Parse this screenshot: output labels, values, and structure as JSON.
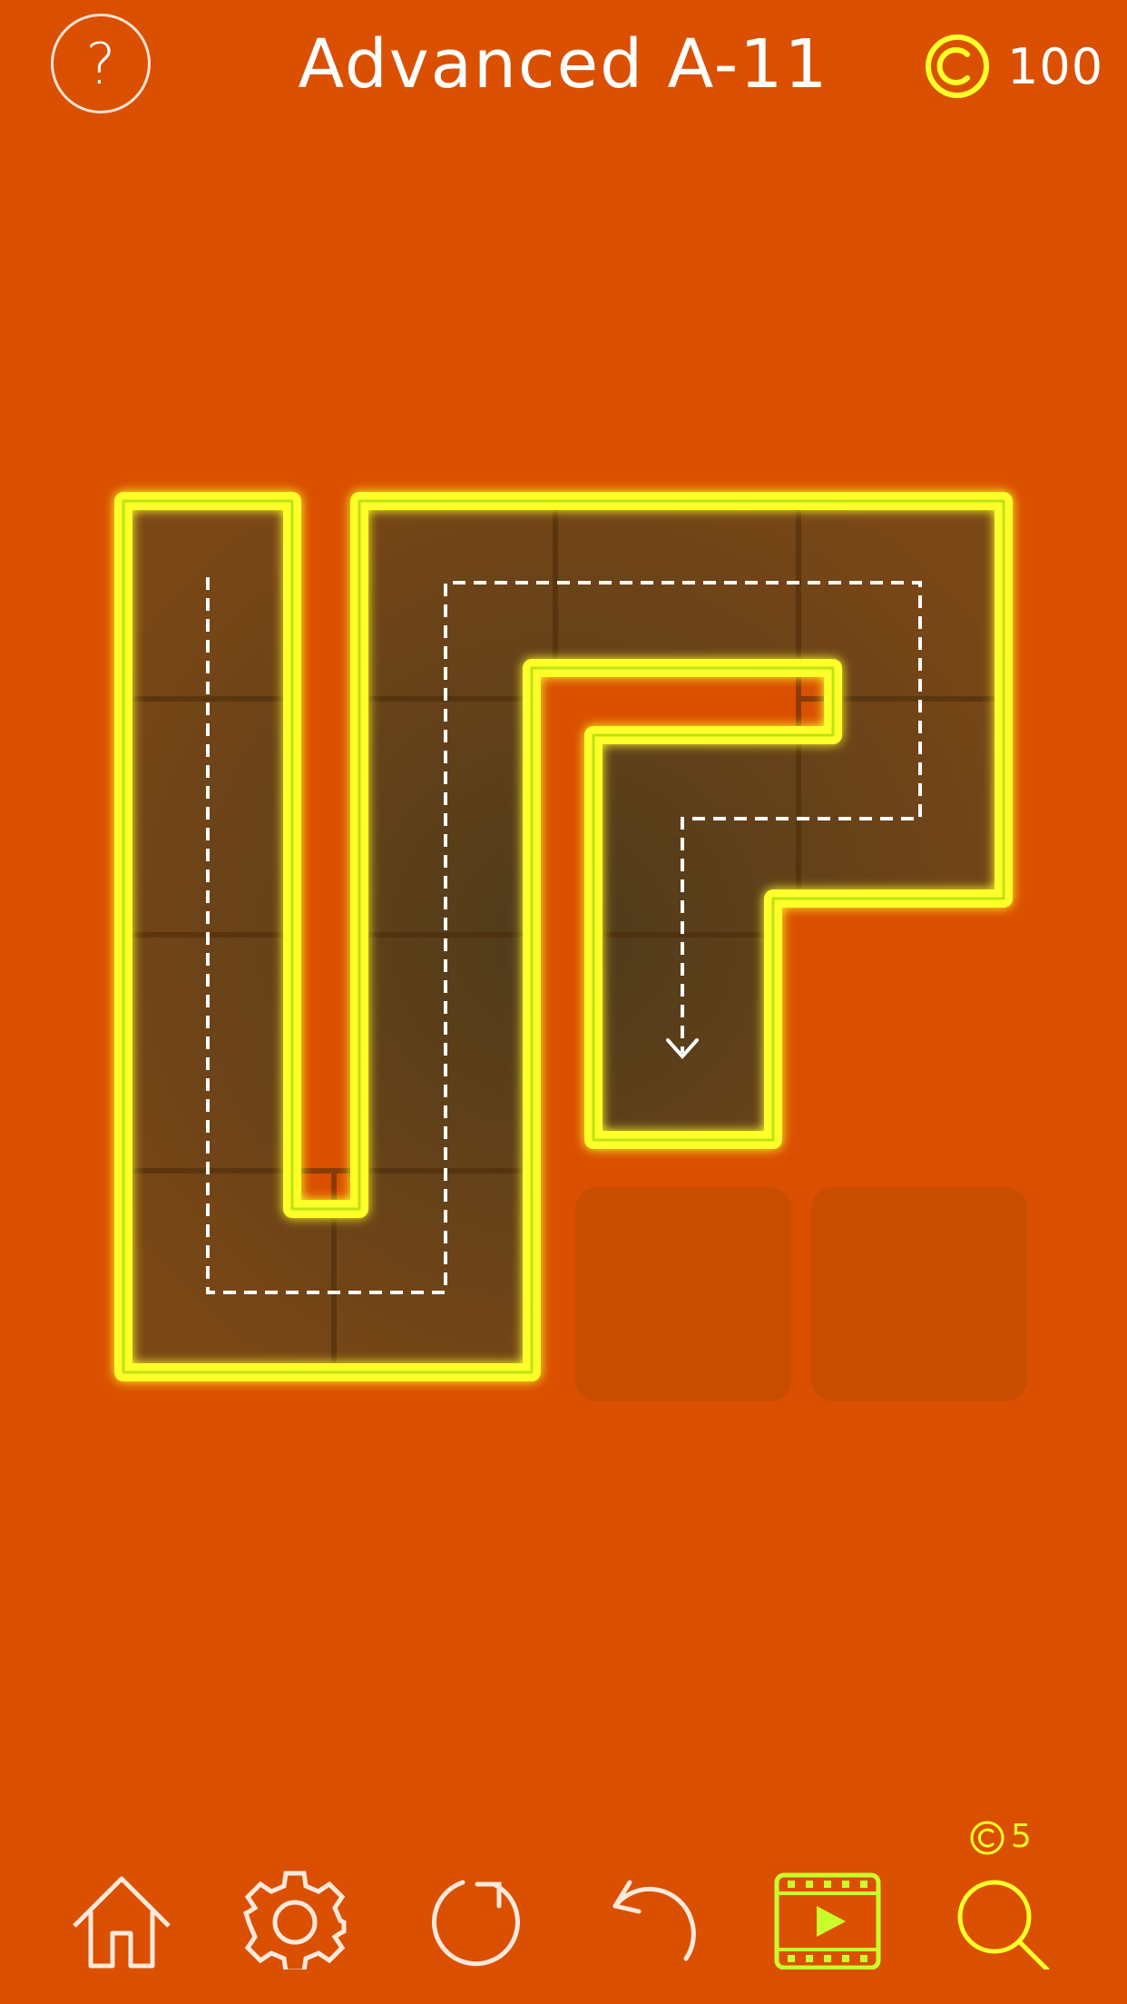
{
  "header": {
    "help_label": "?",
    "title": "Advanced A-11",
    "coins": "100"
  },
  "hint": {
    "cost": "5"
  },
  "toolbar": {
    "items": [
      "home-icon",
      "settings-icon",
      "restart-icon",
      "undo-icon",
      "video-icon",
      "hint-icon"
    ]
  },
  "board": {
    "rows": 4,
    "cols": 4,
    "empty_slots": 2
  },
  "colors": {
    "background": "#da5000",
    "pipe": "#ffff2a",
    "tile_fill": "#6a4418",
    "empty_tile": "#c84d00",
    "hint_accent": "#c8ff2a",
    "text": "#ffffff"
  }
}
